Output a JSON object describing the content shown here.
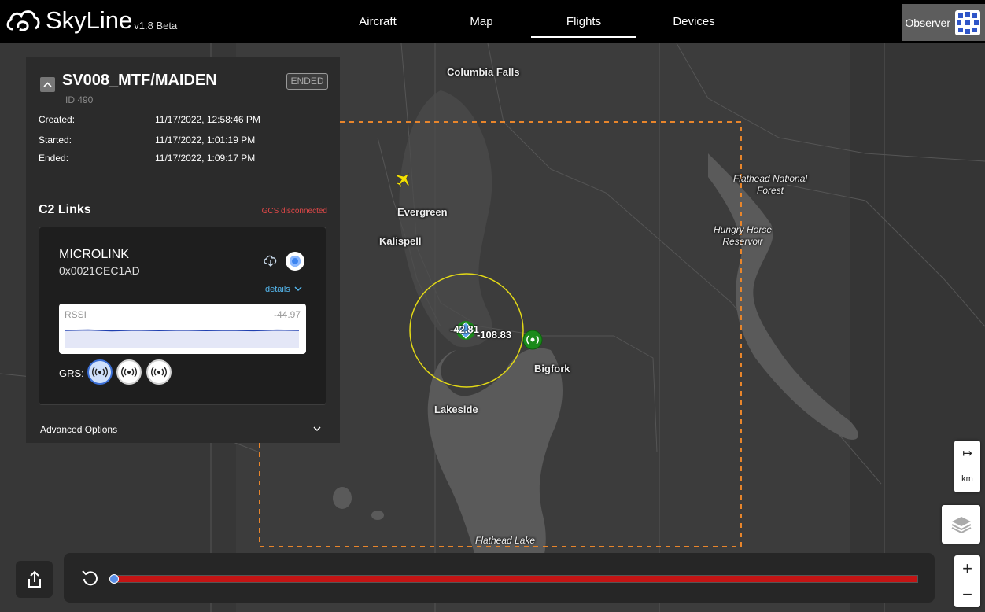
{
  "app": {
    "name": "SkyLine",
    "version": "v1.8 Beta"
  },
  "nav": {
    "tabs": [
      {
        "label": "Aircraft"
      },
      {
        "label": "Map"
      },
      {
        "label": "Flights"
      },
      {
        "label": "Devices"
      }
    ],
    "active_tab": "Flights"
  },
  "user": {
    "role": "Observer"
  },
  "flight": {
    "name": "SV008_MTF/MAIDEN",
    "id_label": "ID 490",
    "status": "ENDED",
    "created_label": "Created:",
    "created": "11/17/2022, 12:58:46 PM",
    "started_label": "Started:",
    "started": "11/17/2022, 1:01:19 PM",
    "ended_label": "Ended:",
    "ended": "11/17/2022, 1:09:17 PM"
  },
  "c2": {
    "title": "C2 Links",
    "status": "GCS disconnected",
    "link": {
      "name": "MICROLINK",
      "address": "0x0021CEC1AD",
      "details_label": "details",
      "rssi_label": "RSSI",
      "rssi_value": "-44.97",
      "grs_label": "GRS:",
      "grs_selected_index": 0
    }
  },
  "advanced_options_label": "Advanced Options",
  "map": {
    "labels": {
      "columbia_falls": "Columbia Falls",
      "evergreen": "Evergreen",
      "kalispell": "Kalispell",
      "bigfork": "Bigfork",
      "lakeside": "Lakeside",
      "flathead_forest": "Flathead National Forest",
      "hungry_horse": "Hungry Horse Reservoir",
      "flathead_lake": "Flathead Lake"
    },
    "aircraft_alt_1": "-42.81",
    "aircraft_alt_2": "-108.83",
    "scale_unit": "km",
    "scale_arrow": "↦",
    "zoom_in": "+",
    "zoom_out": "−",
    "colors": {
      "geofence": "#e8852b",
      "radius_circle": "#e3d916",
      "aircraft": "#f4e000",
      "ground_station": "#1a8a1a"
    }
  },
  "timeline": {
    "progress": 0
  }
}
